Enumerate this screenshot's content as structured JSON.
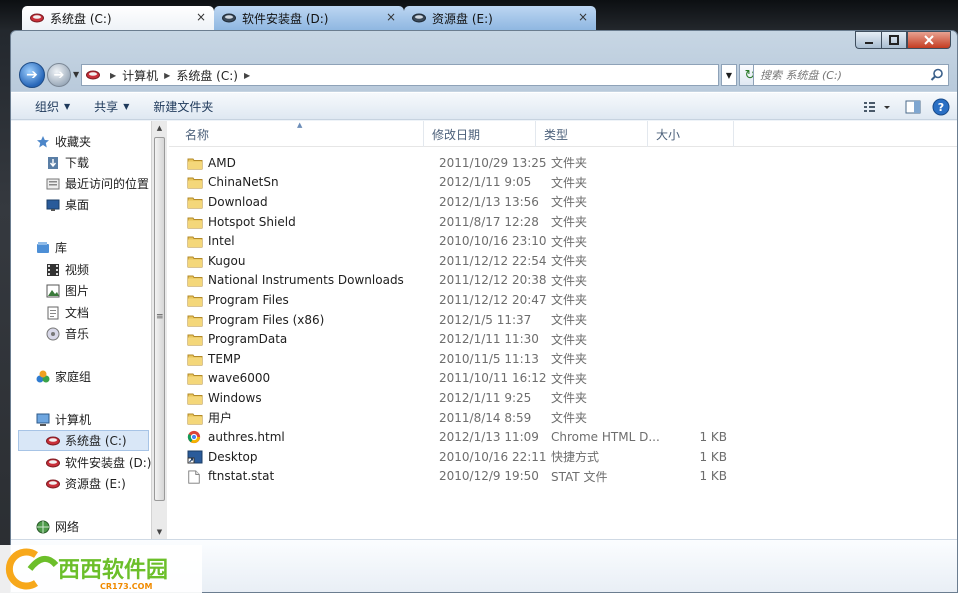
{
  "tabs": [
    {
      "label": "系统盘 (C:)",
      "active": true
    },
    {
      "label": "软件安装盘 (D:)",
      "active": false
    },
    {
      "label": "资源盘 (E:)",
      "active": false
    }
  ],
  "tab_close_glyph": "×",
  "address": {
    "parts": [
      "计算机",
      "系统盘 (C:)"
    ]
  },
  "search": {
    "placeholder": "搜索 系统盘 (C:)"
  },
  "toolbar": {
    "organize": "组织",
    "share": "共享",
    "new_folder": "新建文件夹"
  },
  "nav": {
    "favorites": "收藏夹",
    "downloads": "下载",
    "recent": "最近访问的位置",
    "desktop": "桌面",
    "libraries": "库",
    "videos": "视频",
    "pictures": "图片",
    "documents": "文档",
    "music": "音乐",
    "homegroup": "家庭组",
    "computer": "计算机",
    "drive_c": "系统盘 (C:)",
    "drive_d": "软件安装盘 (D:)",
    "drive_e": "资源盘 (E:)",
    "network": "网络"
  },
  "columns": {
    "name": "名称",
    "date": "修改日期",
    "type": "类型",
    "size": "大小"
  },
  "files": [
    {
      "name": "AMD",
      "date": "2011/10/29 13:25",
      "type": "文件夹",
      "size": "",
      "icon": "folder-icon"
    },
    {
      "name": "ChinaNetSn",
      "date": "2012/1/11 9:05",
      "type": "文件夹",
      "size": "",
      "icon": "folder-icon"
    },
    {
      "name": "Download",
      "date": "2012/1/13 13:56",
      "type": "文件夹",
      "size": "",
      "icon": "folder-icon"
    },
    {
      "name": "Hotspot Shield",
      "date": "2011/8/17 12:28",
      "type": "文件夹",
      "size": "",
      "icon": "folder-icon"
    },
    {
      "name": "Intel",
      "date": "2010/10/16 23:10",
      "type": "文件夹",
      "size": "",
      "icon": "folder-icon"
    },
    {
      "name": "Kugou",
      "date": "2011/12/12 22:54",
      "type": "文件夹",
      "size": "",
      "icon": "folder-icon"
    },
    {
      "name": "National Instruments Downloads",
      "date": "2011/12/12 20:38",
      "type": "文件夹",
      "size": "",
      "icon": "folder-icon"
    },
    {
      "name": "Program Files",
      "date": "2011/12/12 20:47",
      "type": "文件夹",
      "size": "",
      "icon": "folder-icon"
    },
    {
      "name": "Program Files (x86)",
      "date": "2012/1/5 11:37",
      "type": "文件夹",
      "size": "",
      "icon": "folder-icon"
    },
    {
      "name": "ProgramData",
      "date": "2012/1/11 11:30",
      "type": "文件夹",
      "size": "",
      "icon": "folder-icon"
    },
    {
      "name": "TEMP",
      "date": "2010/11/5 11:13",
      "type": "文件夹",
      "size": "",
      "icon": "folder-icon"
    },
    {
      "name": "wave6000",
      "date": "2011/10/11 16:12",
      "type": "文件夹",
      "size": "",
      "icon": "folder-icon"
    },
    {
      "name": "Windows",
      "date": "2012/1/11 9:25",
      "type": "文件夹",
      "size": "",
      "icon": "folder-icon"
    },
    {
      "name": "用户",
      "date": "2011/8/14 8:59",
      "type": "文件夹",
      "size": "",
      "icon": "folder-icon"
    },
    {
      "name": "authres.html",
      "date": "2012/1/13 11:09",
      "type": "Chrome HTML D...",
      "size": "1 KB",
      "icon": "chrome-icon"
    },
    {
      "name": "Desktop",
      "date": "2010/10/16 22:11",
      "type": "快捷方式",
      "size": "1 KB",
      "icon": "shortcut-icon"
    },
    {
      "name": "ftnstat.stat",
      "date": "2010/12/9 19:50",
      "type": "STAT 文件",
      "size": "1 KB",
      "icon": "file-icon"
    }
  ],
  "watermark": {
    "brand": "西西软件园",
    "domain": "CR173.COM"
  },
  "colors": {
    "folder": "#e9c55b",
    "selection": "#d9e7f7",
    "accent": "#1e395b"
  }
}
